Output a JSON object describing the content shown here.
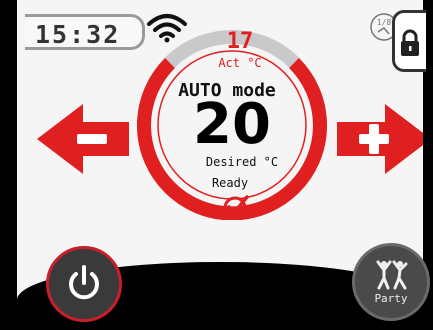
{
  "status_bar": {
    "time": "15:32",
    "wifi_icon": "wifi-icon",
    "schedule_icon": "schedule-1-8-icon",
    "schedule_label": "1/8",
    "lock_icon": "lock-icon"
  },
  "thermostat": {
    "actual_temperature": "17",
    "actual_label": "Act °C",
    "mode": "AUTO mode",
    "desired_temperature": "20",
    "desired_label": "Desired °C",
    "status": "Ready",
    "status_icon": "check-circle-icon"
  },
  "controls": {
    "decrease_icon": "minus-arrow-icon",
    "increase_icon": "plus-arrow-icon",
    "power_icon": "power-icon",
    "party_icon": "party-people-icon",
    "party_label": "Party"
  },
  "colors": {
    "accent_red": "#e02020",
    "background": "#f5f5f5",
    "frame": "#000000"
  }
}
